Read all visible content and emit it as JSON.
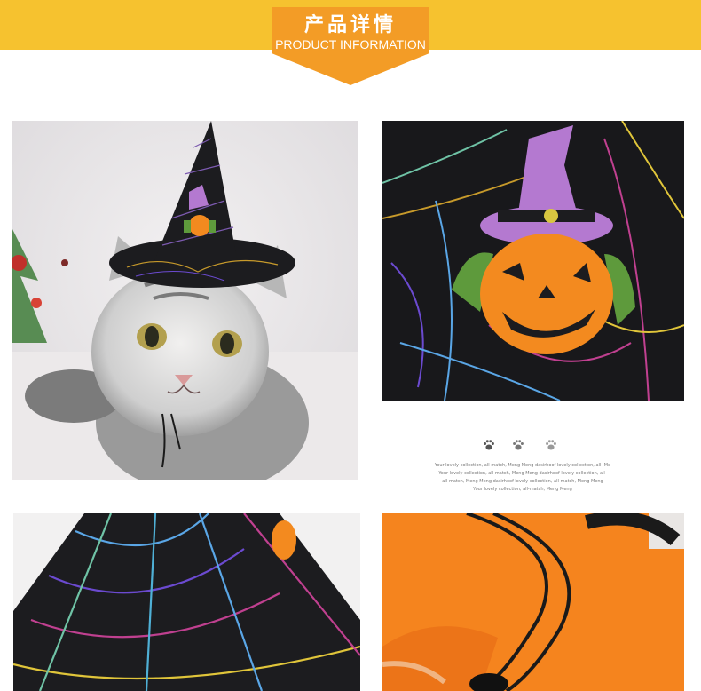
{
  "header": {
    "title": "产品详情",
    "subtitle": "PRODUCT INFORMATION"
  },
  "caption": {
    "lines": [
      "Your lovely collection, all-match, Meng Meng dasirhoof lovely collection, all- Me",
      "Your lovely collection, all-match, Meng Meng dasirhoof lovely collection, all-",
      "all-match, Meng Meng dasirhoof lovely collection, all-match, Meng Meng",
      "Your lovely collection, all-match, Meng Meng"
    ]
  },
  "icons": [
    "paw-icon",
    "paw-icon",
    "paw-icon"
  ],
  "photos": [
    {
      "name": "cat-wearing-witch-hat-photo"
    },
    {
      "name": "hat-pumpkin-charm-closeup-photo"
    },
    {
      "name": "hat-spiderweb-fabric-closeup-photo"
    },
    {
      "name": "hat-orange-lining-strap-photo"
    }
  ],
  "colors": {
    "banner": "#f6c22f",
    "badge": "#f39c26",
    "hat_black": "#1c1c1f",
    "lining_orange": "#f5841e",
    "pumpkin": "#f38a1f",
    "hat_purple": "#b479d0"
  }
}
